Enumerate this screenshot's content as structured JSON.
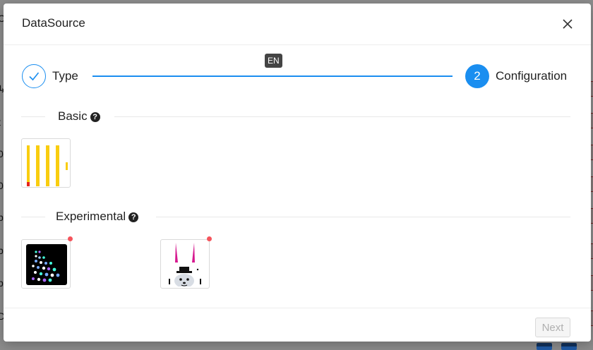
{
  "modal": {
    "title": "DataSource",
    "close_icon": "close-icon"
  },
  "steps": [
    {
      "label": "Type",
      "status": "done",
      "icon": "check-icon"
    },
    {
      "label": "Configuration",
      "status": "active",
      "number": "2"
    }
  ],
  "language_badge": "EN",
  "sections": {
    "basic": {
      "label": "Basic",
      "help_icon": "question-circle-icon",
      "items": [
        {
          "icon": "clickhouse-logo-icon",
          "new": false
        }
      ]
    },
    "experimental": {
      "label": "Experimental",
      "help_icon": "question-circle-icon",
      "items": [
        {
          "icon": "dot-matrix-logo-icon",
          "new": true
        },
        {
          "icon": "rabbit-magician-logo-icon",
          "new": true
        }
      ]
    }
  },
  "footer": {
    "next_label": "Next",
    "next_disabled": true
  },
  "colors": {
    "primary": "#1a8ef0",
    "new_dot": "#f5545c",
    "clickhouse_yellow": "#f9cd0f"
  }
}
